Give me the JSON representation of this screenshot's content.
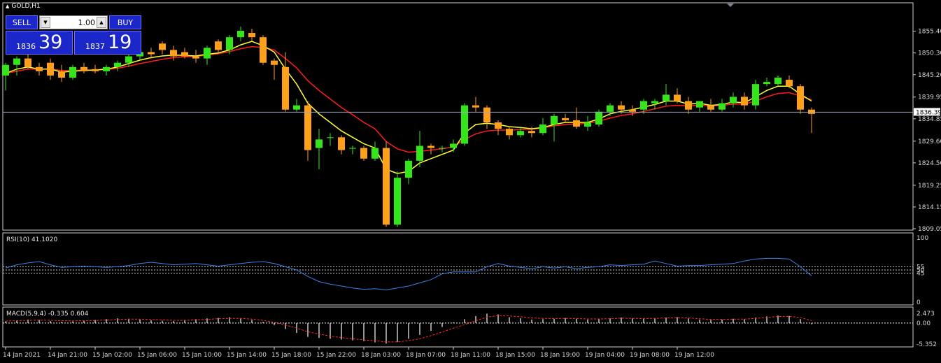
{
  "window_title": "GOLD,H1",
  "trade_panel": {
    "sell_label": "SELL",
    "buy_label": "BUY",
    "lot": "1.00",
    "sell_small": "1836",
    "sell_big": "39",
    "buy_small": "1837",
    "buy_big": "19"
  },
  "colors": {
    "background": "#000000",
    "bull": "#33e61a",
    "bear": "#ffa01a",
    "ma_fast": "#ffff33",
    "ma_slow": "#ff1a1a",
    "rsi": "#3b82e8",
    "macd_signal": "#ff2a2a",
    "grid": "#5a6070"
  },
  "chart_data": [
    {
      "type": "candlestick",
      "symbol": "GOLD",
      "timeframe": "H1",
      "ylim": [
        1809.05,
        1857.8
      ],
      "yticks": [
        "1855.40",
        "1850.30",
        "1845.20",
        "1839.95",
        "1834.85",
        "1829.60",
        "1824.50",
        "1819.25",
        "1814.15",
        "1809.05"
      ],
      "current_price": "1836.39",
      "xticks": [
        "14 Jan 2021",
        "14 Jan 21:00",
        "15 Jan 02:00",
        "15 Jan 06:00",
        "15 Jan 10:00",
        "15 Jan 14:00",
        "15 Jan 18:00",
        "15 Jan 22:00",
        "18 Jan 03:00",
        "18 Jan 07:00",
        "18 Jan 11:00",
        "18 Jan 15:00",
        "18 Jan 19:00",
        "19 Jan 04:00",
        "19 Jan 08:00",
        "19 Jan 12:00"
      ],
      "candles": [
        [
          1845.0,
          1848.0,
          1841.5,
          1847.5
        ],
        [
          1847.5,
          1849.5,
          1845.0,
          1849.0
        ],
        [
          1849.0,
          1850.5,
          1846.5,
          1847.0
        ],
        [
          1847.0,
          1848.0,
          1845.0,
          1846.0
        ],
        [
          1848.0,
          1849.0,
          1844.0,
          1845.0
        ],
        [
          1846.0,
          1847.5,
          1843.5,
          1844.5
        ],
        [
          1844.5,
          1847.5,
          1844.0,
          1847.0
        ],
        [
          1847.0,
          1848.0,
          1845.5,
          1846.0
        ],
        [
          1846.5,
          1847.5,
          1845.5,
          1846.0
        ],
        [
          1846.0,
          1847.5,
          1845.0,
          1847.0
        ],
        [
          1847.0,
          1848.5,
          1846.0,
          1848.0
        ],
        [
          1848.0,
          1850.0,
          1847.0,
          1849.5
        ],
        [
          1849.5,
          1851.0,
          1848.5,
          1850.5
        ],
        [
          1850.5,
          1851.5,
          1849.0,
          1850.0
        ],
        [
          1852.5,
          1853.0,
          1850.0,
          1851.0
        ],
        [
          1851.0,
          1852.0,
          1848.5,
          1849.5
        ],
        [
          1850.5,
          1851.5,
          1849.0,
          1849.5
        ],
        [
          1849.5,
          1851.0,
          1848.0,
          1849.0
        ],
        [
          1849.0,
          1852.0,
          1847.5,
          1851.5
        ],
        [
          1853.0,
          1853.5,
          1850.5,
          1851.0
        ],
        [
          1851.0,
          1854.5,
          1850.0,
          1854.0
        ],
        [
          1854.0,
          1856.5,
          1853.0,
          1855.5
        ],
        [
          1855.0,
          1856.0,
          1853.0,
          1854.0
        ],
        [
          1854.0,
          1854.5,
          1847.5,
          1848.0
        ],
        [
          1848.5,
          1849.0,
          1844.0,
          1847.5
        ],
        [
          1847.0,
          1850.5,
          1836.5,
          1837.0
        ],
        [
          1837.0,
          1839.5,
          1836.5,
          1838.0
        ],
        [
          1838.0,
          1839.0,
          1825.0,
          1827.5
        ],
        [
          1828.0,
          1832.5,
          1823.0,
          1830.0
        ],
        [
          1830.5,
          1831.5,
          1828.5,
          1830.5
        ],
        [
          1830.5,
          1831.0,
          1826.5,
          1827.5
        ],
        [
          1828.0,
          1828.5,
          1826.5,
          1828.0
        ],
        [
          1828.0,
          1828.5,
          1825.0,
          1825.5
        ],
        [
          1825.5,
          1829.5,
          1825.0,
          1828.0
        ],
        [
          1828.0,
          1829.5,
          1809.5,
          1810.0
        ],
        [
          1810.0,
          1822.5,
          1809.5,
          1821.0
        ],
        [
          1821.0,
          1825.5,
          1819.5,
          1825.0
        ],
        [
          1825.0,
          1832.0,
          1823.5,
          1828.5
        ],
        [
          1828.5,
          1829.0,
          1826.5,
          1828.0
        ],
        [
          1828.0,
          1828.5,
          1827.0,
          1828.0
        ],
        [
          1828.0,
          1830.0,
          1827.0,
          1829.0
        ],
        [
          1829.0,
          1838.5,
          1828.5,
          1838.0
        ],
        [
          1838.0,
          1840.0,
          1836.5,
          1837.5
        ],
        [
          1837.5,
          1838.0,
          1832.5,
          1834.0
        ],
        [
          1834.0,
          1834.5,
          1831.0,
          1832.5
        ],
        [
          1832.5,
          1833.0,
          1830.0,
          1831.0
        ],
        [
          1831.0,
          1833.0,
          1830.5,
          1832.0
        ],
        [
          1832.0,
          1833.0,
          1830.5,
          1831.5
        ],
        [
          1831.5,
          1835.0,
          1831.0,
          1833.5
        ],
        [
          1833.5,
          1836.0,
          1829.5,
          1835.5
        ],
        [
          1835.0,
          1836.0,
          1834.0,
          1834.5
        ],
        [
          1834.5,
          1837.5,
          1832.5,
          1833.0
        ],
        [
          1833.0,
          1835.5,
          1832.0,
          1834.0
        ],
        [
          1833.5,
          1837.0,
          1833.0,
          1836.5
        ],
        [
          1836.5,
          1838.5,
          1835.5,
          1838.0
        ],
        [
          1838.0,
          1839.0,
          1836.0,
          1837.0
        ],
        [
          1837.0,
          1838.0,
          1835.5,
          1836.5
        ],
        [
          1837.0,
          1839.5,
          1836.0,
          1839.0
        ],
        [
          1838.5,
          1839.5,
          1837.0,
          1839.0
        ],
        [
          1839.0,
          1843.0,
          1838.0,
          1840.5
        ],
        [
          1840.5,
          1842.0,
          1838.5,
          1839.0
        ],
        [
          1839.0,
          1840.0,
          1836.0,
          1837.0
        ],
        [
          1837.5,
          1839.0,
          1836.5,
          1839.0
        ],
        [
          1838.0,
          1839.5,
          1836.5,
          1837.0
        ],
        [
          1837.0,
          1839.5,
          1836.5,
          1838.5
        ],
        [
          1838.5,
          1841.0,
          1837.5,
          1840.0
        ],
        [
          1840.0,
          1841.0,
          1837.0,
          1838.0
        ],
        [
          1838.0,
          1844.0,
          1837.0,
          1843.0
        ],
        [
          1843.0,
          1844.5,
          1842.5,
          1843.5
        ],
        [
          1843.0,
          1845.0,
          1842.5,
          1844.5
        ],
        [
          1844.0,
          1845.0,
          1842.0,
          1842.5
        ],
        [
          1842.5,
          1843.0,
          1836.0,
          1837.0
        ],
        [
          1837.0,
          1837.5,
          1831.5,
          1836.0
        ]
      ],
      "ma_fast": [
        1845.5,
        1846.5,
        1847.0,
        1846.5,
        1846.5,
        1845.8,
        1846.0,
        1846.2,
        1846.3,
        1846.5,
        1847.0,
        1847.8,
        1848.6,
        1849.2,
        1849.6,
        1849.8,
        1849.7,
        1849.6,
        1850.0,
        1850.3,
        1851.0,
        1852.2,
        1853.0,
        1852.0,
        1850.5,
        1846.5,
        1843.0,
        1838.5,
        1836.0,
        1834.0,
        1832.0,
        1830.5,
        1829.0,
        1828.0,
        1823.0,
        1822.0,
        1822.5,
        1824.5,
        1825.5,
        1826.5,
        1827.5,
        1831.5,
        1833.5,
        1833.8,
        1833.5,
        1833.0,
        1832.8,
        1832.5,
        1832.8,
        1833.5,
        1834.0,
        1834.0,
        1834.0,
        1834.8,
        1836.0,
        1836.6,
        1837.0,
        1837.6,
        1838.2,
        1839.0,
        1839.0,
        1838.3,
        1838.5,
        1838.0,
        1838.2,
        1838.8,
        1838.6,
        1840.0,
        1841.5,
        1842.5,
        1842.5,
        1840.6,
        1839.0
      ],
      "ma_slow": [
        1845.5,
        1846.0,
        1846.5,
        1846.5,
        1846.5,
        1846.2,
        1846.2,
        1846.3,
        1846.3,
        1846.4,
        1846.7,
        1847.2,
        1847.8,
        1848.3,
        1848.8,
        1849.2,
        1849.4,
        1849.5,
        1849.8,
        1850.1,
        1850.6,
        1851.3,
        1851.8,
        1851.6,
        1851.0,
        1849.0,
        1846.8,
        1843.8,
        1841.5,
        1839.5,
        1837.5,
        1835.8,
        1834.0,
        1832.5,
        1829.5,
        1827.8,
        1827.0,
        1827.2,
        1827.5,
        1827.8,
        1828.3,
        1830.0,
        1831.3,
        1832.0,
        1832.2,
        1832.2,
        1832.3,
        1832.4,
        1832.7,
        1833.2,
        1833.5,
        1833.6,
        1833.8,
        1834.3,
        1835.0,
        1835.6,
        1836.0,
        1836.6,
        1837.2,
        1837.8,
        1838.0,
        1837.9,
        1838.0,
        1837.9,
        1838.0,
        1838.3,
        1838.3,
        1839.0,
        1840.0,
        1840.8,
        1841.0,
        1840.2,
        1839.3
      ],
      "rsi": {
        "label": "RSI(10) 41.1020",
        "period": 10,
        "value": 41.102,
        "ylim": [
          0,
          100
        ],
        "levels": [
          55,
          50,
          45
        ],
        "ytick_labels": [
          "100",
          "55",
          "50",
          "45",
          "0"
        ],
        "values": [
          53,
          58,
          61,
          63,
          58,
          54,
          55,
          56,
          55,
          54,
          55,
          57,
          60,
          62,
          60,
          58,
          59,
          60,
          58,
          56,
          58,
          60,
          62,
          63,
          60,
          55,
          50,
          40,
          32,
          28,
          25,
          22,
          20,
          21,
          19,
          22,
          25,
          30,
          35,
          44,
          47,
          47,
          47,
          55,
          60,
          56,
          54,
          52,
          55,
          53,
          55,
          52,
          54,
          55,
          58,
          57,
          58,
          59,
          64,
          60,
          56,
          57,
          57,
          58,
          59,
          60,
          64,
          67,
          68,
          68,
          67,
          55,
          41
        ]
      },
      "macd": {
        "label": "MACD(5,9,4) -0.335 0.604",
        "value": -0.335,
        "signal_value": 0.604,
        "ylim": [
          -5.352,
          2.473
        ],
        "ytick_labels": [
          "2.473",
          "0.00",
          "-5.352"
        ],
        "hist": [
          0.4,
          0.7,
          0.9,
          0.8,
          0.5,
          0.3,
          0.4,
          0.6,
          0.8,
          1.0,
          1.2,
          1.1,
          0.9,
          0.7,
          0.6,
          0.5,
          0.8,
          1.0,
          1.2,
          1.3,
          1.5,
          1.2,
          0.8,
          0.3,
          -0.5,
          -1.5,
          -2.5,
          -3.5,
          -3.8,
          -4.0,
          -4.2,
          -4.4,
          -4.6,
          -4.9,
          -5.2,
          -4.8,
          -4.0,
          -3.0,
          -2.0,
          -1.0,
          0.2,
          1.0,
          1.8,
          2.4,
          2.2,
          1.5,
          1.2,
          0.9,
          1.0,
          1.1,
          1.3,
          1.1,
          0.9,
          1.0,
          1.2,
          1.4,
          1.2,
          1.1,
          1.2,
          1.4,
          1.5,
          1.2,
          0.9,
          0.8,
          0.9,
          1.1,
          1.0,
          1.4,
          1.7,
          1.9,
          1.8,
          1.0,
          -0.3
        ],
        "signal": [
          0.5,
          0.6,
          0.7,
          0.75,
          0.7,
          0.6,
          0.55,
          0.6,
          0.65,
          0.75,
          0.9,
          1.0,
          1.0,
          0.9,
          0.8,
          0.7,
          0.7,
          0.8,
          0.95,
          1.1,
          1.2,
          1.2,
          1.0,
          0.7,
          0.2,
          -0.5,
          -1.3,
          -2.2,
          -2.8,
          -3.3,
          -3.7,
          -4.0,
          -4.3,
          -4.5,
          -4.8,
          -4.8,
          -4.5,
          -4.0,
          -3.2,
          -2.3,
          -1.3,
          -0.4,
          0.6,
          1.5,
          1.9,
          1.8,
          1.6,
          1.3,
          1.2,
          1.15,
          1.2,
          1.15,
          1.05,
          1.05,
          1.1,
          1.25,
          1.2,
          1.15,
          1.2,
          1.3,
          1.4,
          1.3,
          1.1,
          0.95,
          0.95,
          1.0,
          1.0,
          1.2,
          1.45,
          1.65,
          1.7,
          1.4,
          0.6
        ]
      }
    }
  ]
}
